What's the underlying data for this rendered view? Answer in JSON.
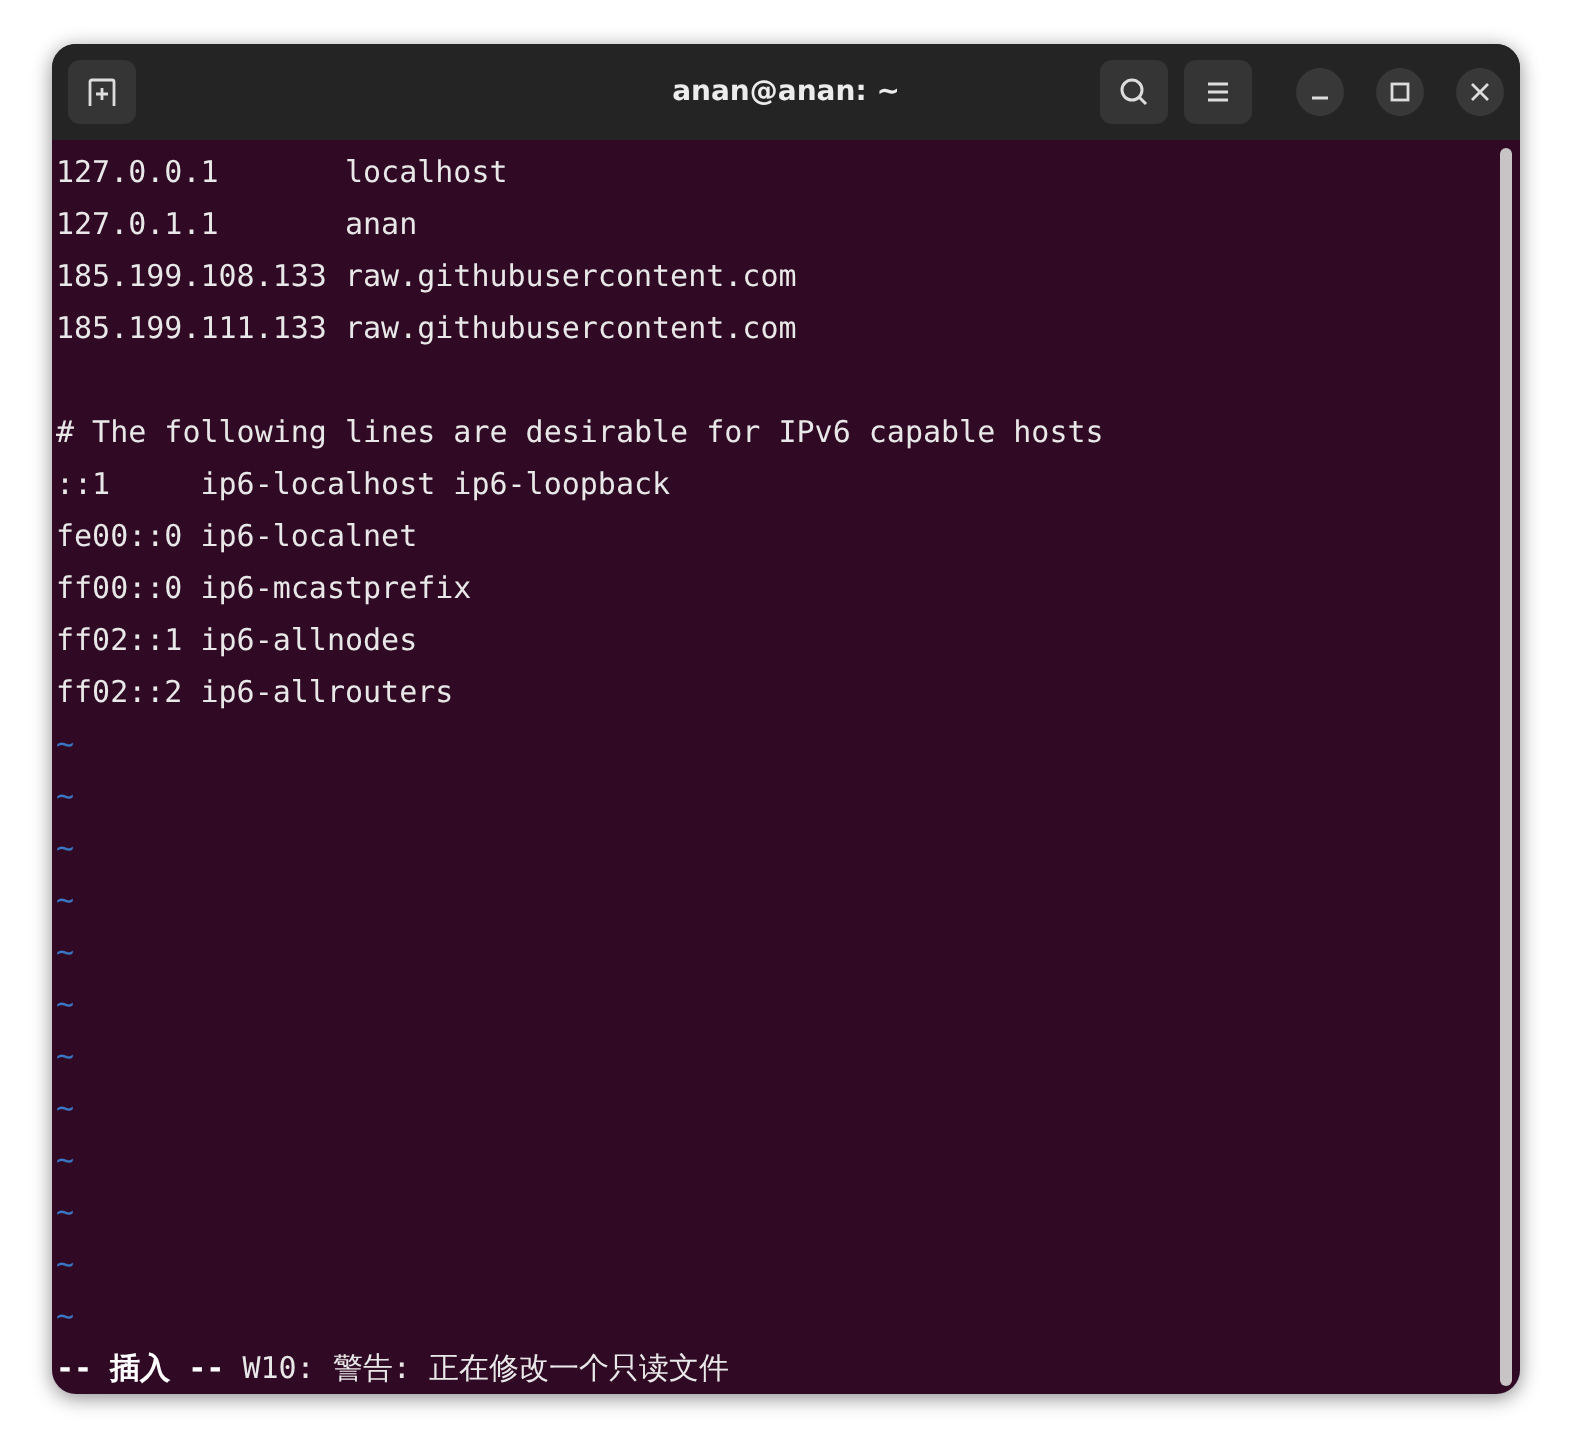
{
  "window": {
    "title": "anan@anan: ~"
  },
  "lines": [
    {
      "kind": "text",
      "text": "127.0.0.1       localhost"
    },
    {
      "kind": "text",
      "text": "127.0.1.1       anan"
    },
    {
      "kind": "text",
      "text": "185.199.108.133 raw.githubusercontent.com"
    },
    {
      "kind": "text",
      "text": "185.199.111.133 raw.githubusercontent.com"
    },
    {
      "kind": "blank"
    },
    {
      "kind": "text",
      "text": "# The following lines are desirable for IPv6 capable hosts"
    },
    {
      "kind": "text",
      "text": "::1     ip6-localhost ip6-loopback"
    },
    {
      "kind": "text",
      "text": "fe00::0 ip6-localnet"
    },
    {
      "kind": "text",
      "text": "ff00::0 ip6-mcastprefix"
    },
    {
      "kind": "text",
      "text": "ff02::1 ip6-allnodes"
    },
    {
      "kind": "text",
      "text": "ff02::2 ip6-allrouters"
    },
    {
      "kind": "tilde",
      "text": "~"
    },
    {
      "kind": "tilde",
      "text": "~"
    },
    {
      "kind": "tilde",
      "text": "~"
    },
    {
      "kind": "tilde",
      "text": "~"
    },
    {
      "kind": "tilde",
      "text": "~"
    },
    {
      "kind": "tilde",
      "text": "~"
    },
    {
      "kind": "tilde",
      "text": "~"
    },
    {
      "kind": "tilde",
      "text": "~"
    },
    {
      "kind": "tilde",
      "text": "~"
    },
    {
      "kind": "tilde",
      "text": "~"
    },
    {
      "kind": "tilde",
      "text": "~"
    },
    {
      "kind": "tilde",
      "text": "~"
    }
  ],
  "status": {
    "mode": "-- 插入 --",
    "message": "W10: 警告: 正在修改一个只读文件"
  }
}
